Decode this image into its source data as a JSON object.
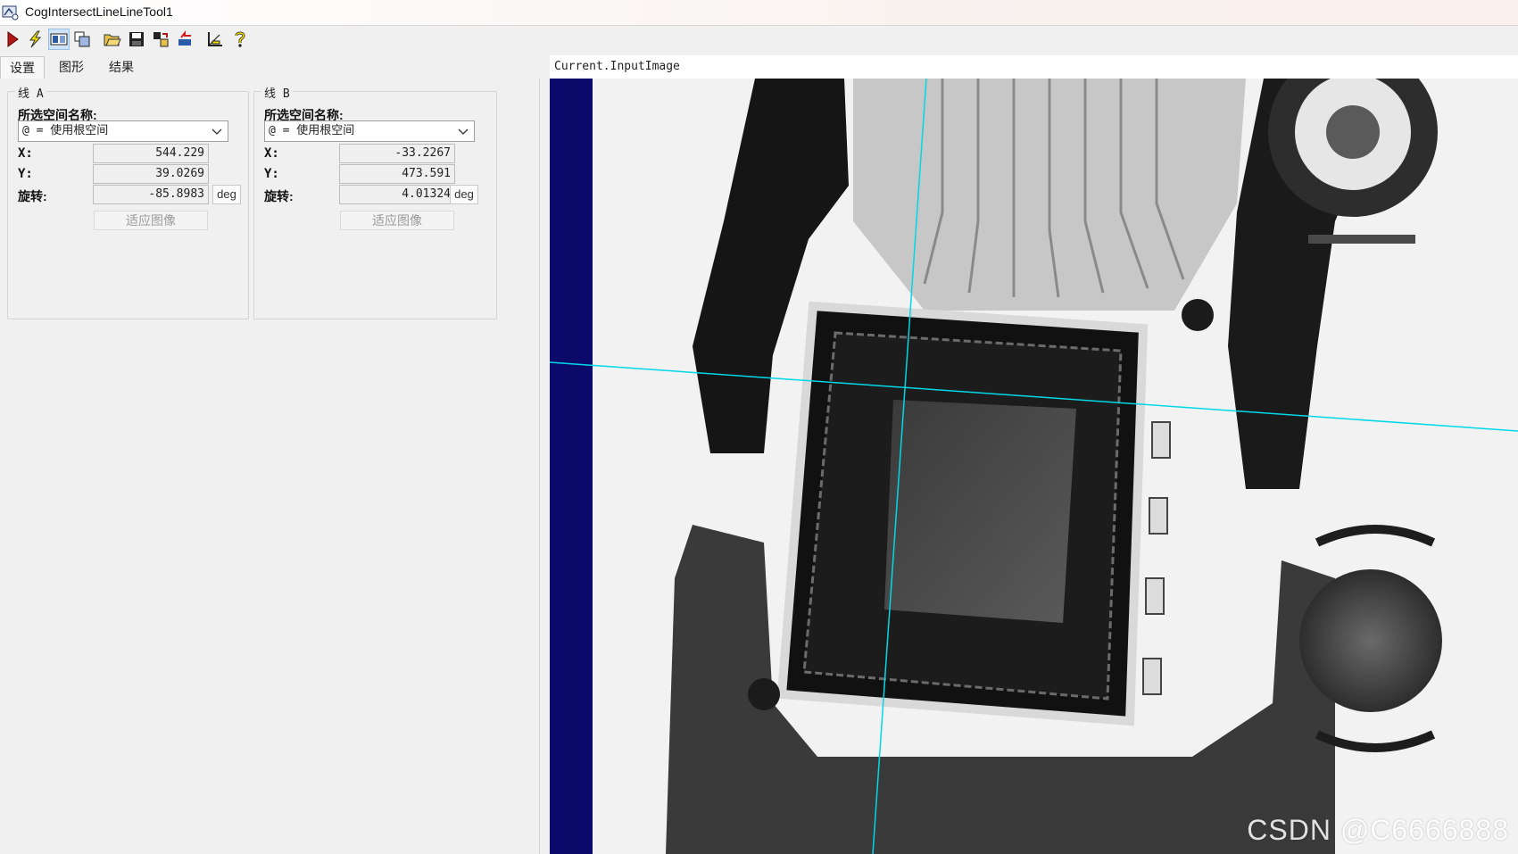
{
  "window": {
    "title": "CogIntersectLineLineTool1"
  },
  "toolbar": {
    "buttons": [
      {
        "name": "run-icon"
      },
      {
        "name": "electric-icon"
      },
      {
        "name": "image-display-icon"
      },
      {
        "name": "copy-image-icon"
      },
      {
        "name": "open-icon"
      },
      {
        "name": "save-icon"
      },
      {
        "name": "export-icon"
      },
      {
        "name": "reset-icon"
      },
      {
        "name": "measure-icon"
      },
      {
        "name": "help-icon"
      }
    ]
  },
  "tabs": [
    {
      "label": "设置",
      "active": true
    },
    {
      "label": "图形",
      "active": false
    },
    {
      "label": "结果",
      "active": false
    }
  ],
  "lineA": {
    "title": "线 A",
    "space_label": "所选空间名称:",
    "space_value": "@ = 使用根空间",
    "x_label": "X:",
    "x_value": "544.229",
    "y_label": "Y:",
    "y_value": "39.0269",
    "rot_label": "旋转:",
    "rot_value": "-85.8983",
    "rot_unit": "deg",
    "fit_label": "适应图像"
  },
  "lineB": {
    "title": "线 B",
    "space_label": "所选空间名称:",
    "space_value": "@ = 使用根空间",
    "x_label": "X:",
    "x_value": "-33.2267",
    "y_label": "Y:",
    "y_value": "473.591",
    "rot_label": "旋转:",
    "rot_value": "4.01324",
    "rot_unit": "deg",
    "fit_label": "适应图像"
  },
  "image": {
    "caption": "Current.InputImage",
    "watermark": "CSDN @C6666888",
    "overlay_color": "#00d8e8"
  }
}
